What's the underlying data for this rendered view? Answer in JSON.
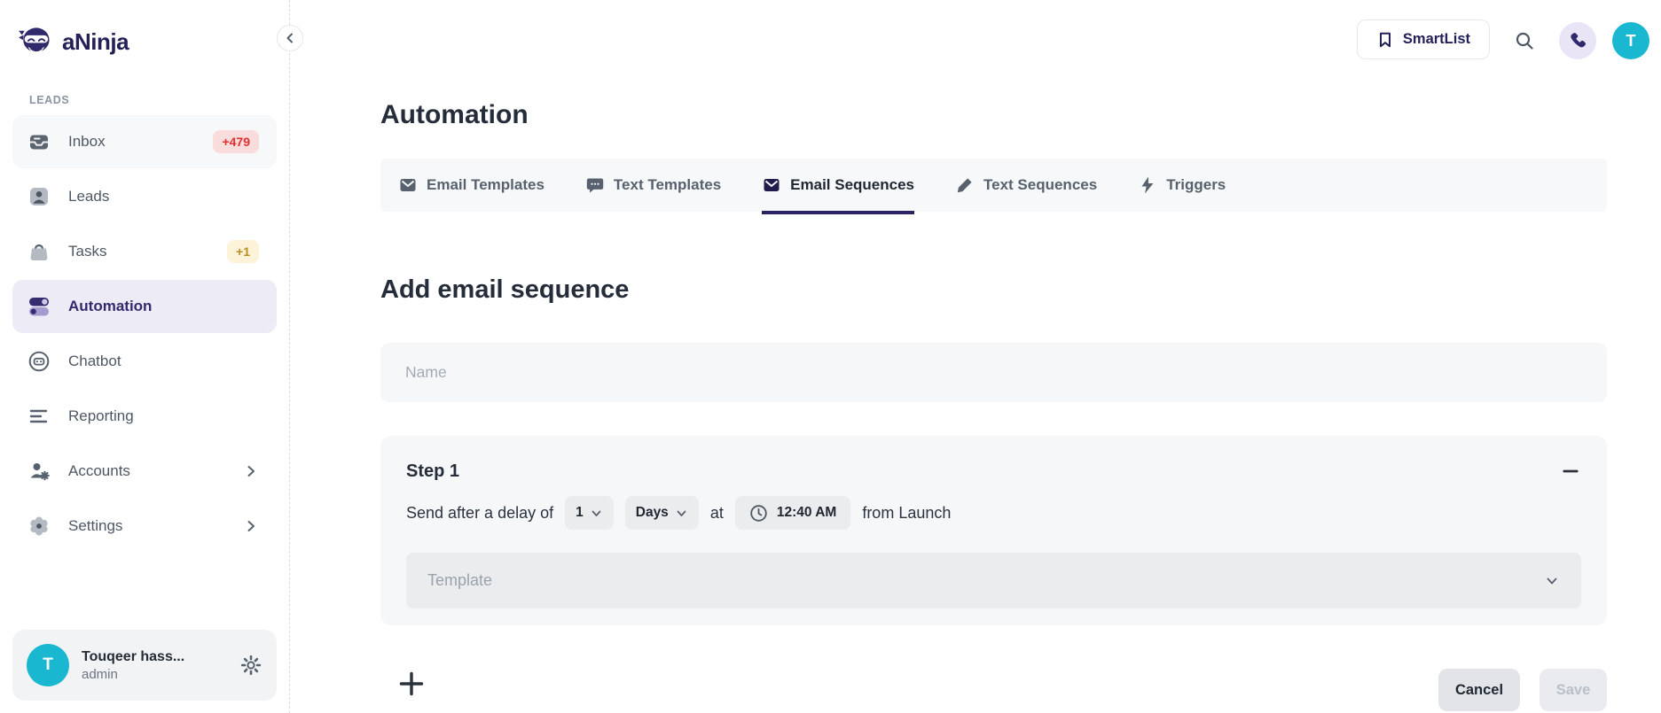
{
  "app": {
    "name": "aNinja"
  },
  "topbar": {
    "smartlist_label": "SmartList"
  },
  "sidebar": {
    "section_label": "LEADS",
    "items": [
      {
        "label": "Inbox",
        "badge": "+479"
      },
      {
        "label": "Leads",
        "badge": ""
      },
      {
        "label": "Tasks",
        "badge": "+1"
      },
      {
        "label": "Automation",
        "badge": ""
      },
      {
        "label": "Chatbot",
        "badge": ""
      },
      {
        "label": "Reporting",
        "badge": ""
      },
      {
        "label": "Accounts",
        "badge": ""
      },
      {
        "label": "Settings",
        "badge": ""
      }
    ],
    "user": {
      "initial": "T",
      "name": "Touqeer hass...",
      "role": "admin"
    }
  },
  "header": {
    "title": "Automation"
  },
  "tabs": [
    {
      "label": "Email Templates",
      "icon": "email-icon",
      "active": false
    },
    {
      "label": "Text Templates",
      "icon": "chat-icon",
      "active": false
    },
    {
      "label": "Email Sequences",
      "icon": "email-icon",
      "active": true
    },
    {
      "label": "Text Sequences",
      "icon": "pencil-icon",
      "active": false
    },
    {
      "label": "Triggers",
      "icon": "lightning-icon",
      "active": false
    }
  ],
  "form": {
    "heading": "Add email sequence",
    "name_placeholder": "Name",
    "step": {
      "title": "Step 1",
      "delay_prefix": "Send after a delay of",
      "delay_value": "1",
      "delay_unit": "Days",
      "at_label": "at",
      "time_value": "12:40 AM",
      "suffix": "from Launch",
      "template_placeholder": "Template"
    },
    "cancel_label": "Cancel",
    "save_label": "Save"
  },
  "colors": {
    "brand_indigo": "#2f2a6b",
    "active_underline": "#2b2261",
    "selected_lavender": "#ecebf6",
    "badge_red_text": "#e03131",
    "badge_red_bg": "#f9dcdc",
    "badge_amber_text": "#c08a1c",
    "badge_amber_bg": "#fdf3d8",
    "avatar_cyan": "#1ab8d0"
  }
}
